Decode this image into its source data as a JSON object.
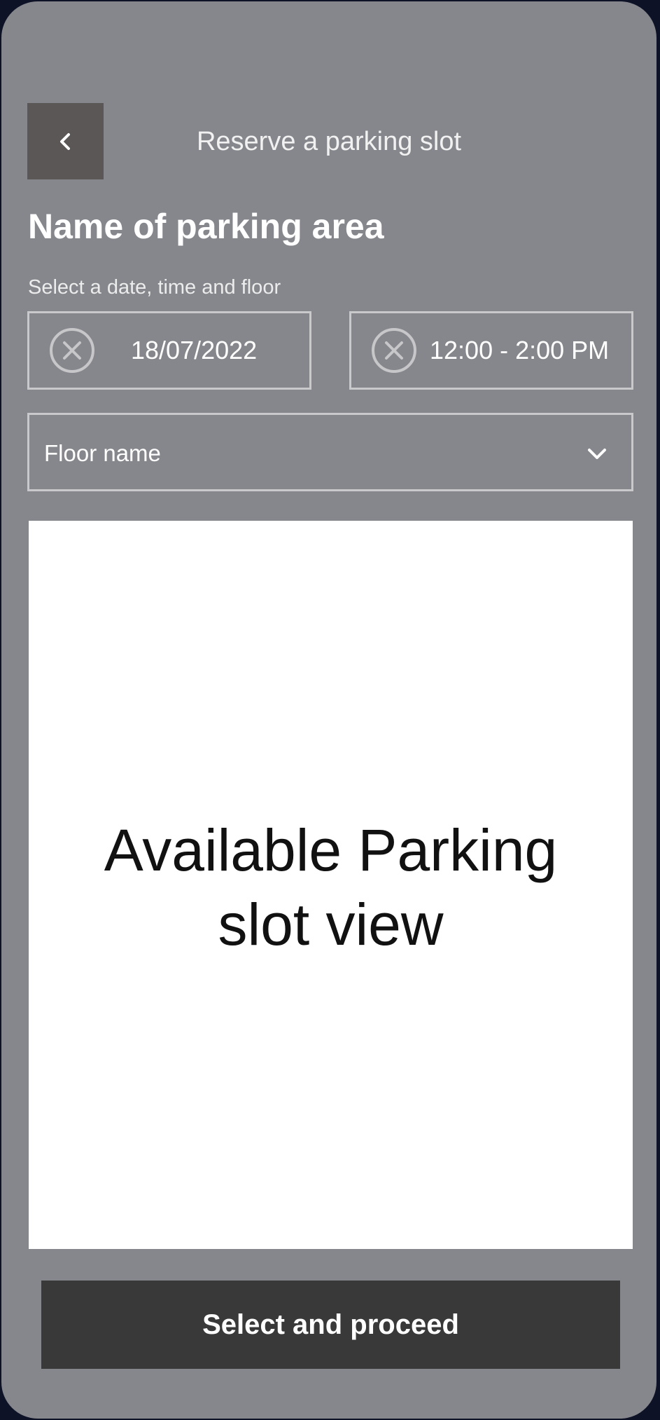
{
  "header": {
    "title": "Reserve a parking slot",
    "back_icon": "chevron-left-icon"
  },
  "parking": {
    "area_name": "Name of parking area",
    "helper_text": "Select a date, time and floor"
  },
  "filters": {
    "date_value": "18/07/2022",
    "time_value": "12:00 - 2:00 PM",
    "clear_icon": "close-circle-icon",
    "floor_placeholder": "Floor name",
    "floor_icon": "chevron-down-icon"
  },
  "slot_view": {
    "label": "Available Parking slot view"
  },
  "actions": {
    "proceed_label": "Select and proceed"
  },
  "colors": {
    "screen_background": "#86878c",
    "back_button": "#5b5756",
    "field_border": "#c9c9cc",
    "proceed_button": "#393939",
    "slot_view_background": "#ffffff"
  }
}
